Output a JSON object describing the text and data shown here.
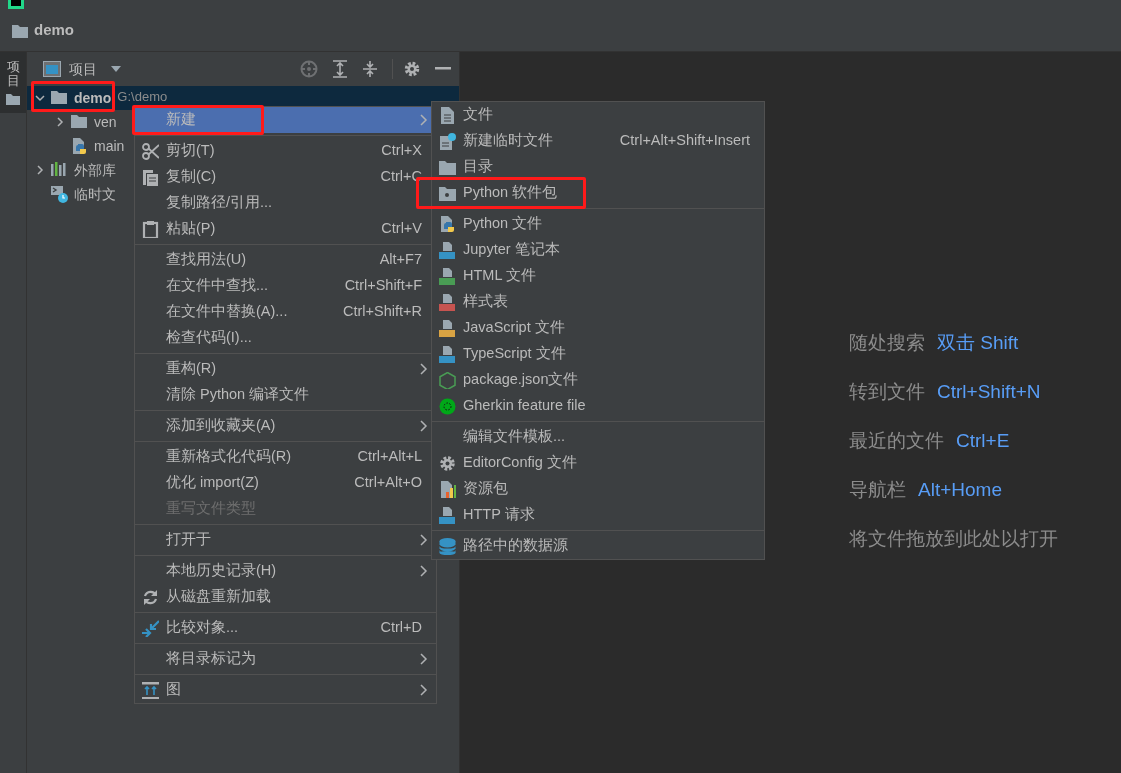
{
  "nav_bar": {
    "crumb": "demo"
  },
  "tool_strip": {
    "tabs": [
      {
        "label": "项目",
        "selected": true
      }
    ]
  },
  "project_panel": {
    "title": "项目",
    "tree": [
      {
        "label": "demo",
        "path": "G:\\demo",
        "expanded": true,
        "selected": true,
        "marked": true,
        "children": [
          {
            "label": "ven",
            "expanded": false,
            "selected": false,
            "marked": false
          },
          {
            "label": "main",
            "selected": false,
            "marked": false
          }
        ]
      },
      {
        "label": "外部库",
        "expanded": false,
        "selected": false,
        "marked": false
      },
      {
        "label": "临时文",
        "selected": false,
        "marked": false
      }
    ]
  },
  "context_menu": [
    {
      "kind": "item",
      "label": "新建",
      "submenu": true,
      "selected": true,
      "marked": true
    },
    {
      "kind": "separator"
    },
    {
      "kind": "item",
      "label": "剪切(T)",
      "shortcut": "Ctrl+X"
    },
    {
      "kind": "item",
      "label": "复制(C)",
      "shortcut": "Ctrl+C"
    },
    {
      "kind": "item",
      "label": "复制路径/引用..."
    },
    {
      "kind": "item",
      "label": "粘贴(P)",
      "shortcut": "Ctrl+V"
    },
    {
      "kind": "separator"
    },
    {
      "kind": "item",
      "label": "查找用法(U)",
      "shortcut": "Alt+F7"
    },
    {
      "kind": "item",
      "label": "在文件中查找...",
      "shortcut": "Ctrl+Shift+F"
    },
    {
      "kind": "item",
      "label": "在文件中替换(A)...",
      "shortcut": "Ctrl+Shift+R"
    },
    {
      "kind": "item",
      "label": "检查代码(I)..."
    },
    {
      "kind": "separator"
    },
    {
      "kind": "item",
      "label": "重构(R)",
      "submenu": true
    },
    {
      "kind": "item",
      "label": "清除 Python 编译文件"
    },
    {
      "kind": "separator"
    },
    {
      "kind": "item",
      "label": "添加到收藏夹(A)",
      "submenu": true
    },
    {
      "kind": "separator"
    },
    {
      "kind": "item",
      "label": "重新格式化代码(R)",
      "shortcut": "Ctrl+Alt+L"
    },
    {
      "kind": "item",
      "label": "优化 import(Z)",
      "shortcut": "Ctrl+Alt+O"
    },
    {
      "kind": "item",
      "label": "重写文件类型",
      "disabled": true
    },
    {
      "kind": "separator"
    },
    {
      "kind": "item",
      "label": "打开于",
      "submenu": true
    },
    {
      "kind": "separator"
    },
    {
      "kind": "item",
      "label": "本地历史记录(H)",
      "submenu": true
    },
    {
      "kind": "item",
      "label": "从磁盘重新加载"
    },
    {
      "kind": "separator"
    },
    {
      "kind": "item",
      "label": "比较对象...",
      "shortcut": "Ctrl+D"
    },
    {
      "kind": "separator"
    },
    {
      "kind": "item",
      "label": "将目录标记为",
      "submenu": true
    },
    {
      "kind": "separator"
    },
    {
      "kind": "item",
      "label": "图",
      "submenu": true
    }
  ],
  "new_submenu": [
    {
      "kind": "item",
      "label": "文件"
    },
    {
      "kind": "item",
      "label": "新建临时文件",
      "shortcut": "Ctrl+Alt+Shift+Insert"
    },
    {
      "kind": "item",
      "label": "目录"
    },
    {
      "kind": "item",
      "label": "Python 软件包",
      "marked": true
    },
    {
      "kind": "separator"
    },
    {
      "kind": "item",
      "label": "Python 文件"
    },
    {
      "kind": "item",
      "label": "Jupyter 笔记本"
    },
    {
      "kind": "item",
      "label": "HTML 文件"
    },
    {
      "kind": "item",
      "label": "样式表"
    },
    {
      "kind": "item",
      "label": "JavaScript 文件"
    },
    {
      "kind": "item",
      "label": "TypeScript 文件"
    },
    {
      "kind": "item",
      "label": "package.json文件"
    },
    {
      "kind": "item",
      "label": "Gherkin feature file"
    },
    {
      "kind": "separator"
    },
    {
      "kind": "item",
      "label": "编辑文件模板..."
    },
    {
      "kind": "item",
      "label": "EditorConfig 文件"
    },
    {
      "kind": "item",
      "label": "资源包"
    },
    {
      "kind": "item",
      "label": "HTTP 请求"
    },
    {
      "kind": "separator"
    },
    {
      "kind": "item",
      "label": "路径中的数据源"
    }
  ],
  "editor_hints": [
    {
      "label": "随处搜索",
      "shortcut": "双击 Shift"
    },
    {
      "label": "转到文件",
      "shortcut": "Ctrl+Shift+N"
    },
    {
      "label": "最近的文件",
      "shortcut": "Ctrl+E"
    },
    {
      "label": "导航栏",
      "shortcut": "Alt+Home"
    },
    {
      "label": "将文件拖放到此处以打开"
    }
  ]
}
